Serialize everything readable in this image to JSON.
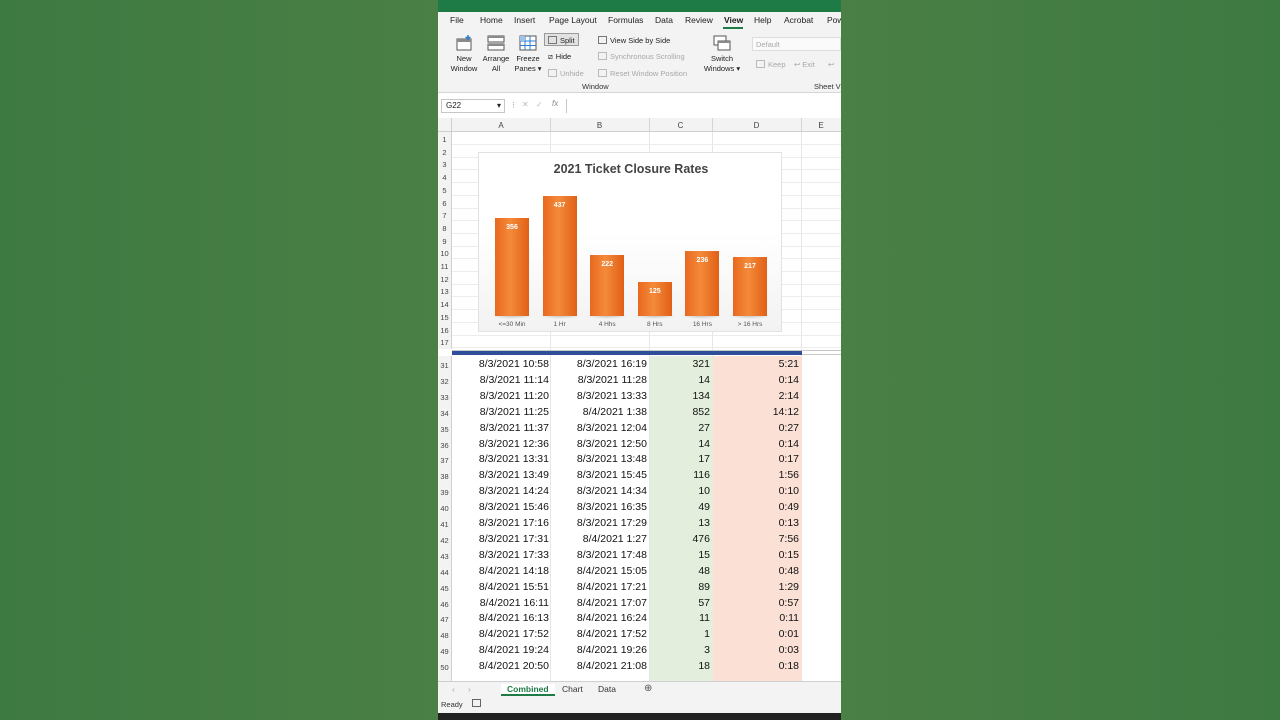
{
  "menu": {
    "items": [
      "File",
      "Home",
      "Insert",
      "Page Layout",
      "Formulas",
      "Data",
      "Review",
      "View",
      "Help",
      "Acrobat",
      "Pow"
    ],
    "active": "View"
  },
  "ribbon": {
    "new_window": "New\nWindow",
    "arrange_all": "Arrange\nAll",
    "freeze_panes": "Freeze\nPanes",
    "split": "Split",
    "hide": "Hide",
    "unhide": "Unhide",
    "view_side_by_side": "View Side by Side",
    "synchronous_scrolling": "Synchronous Scrolling",
    "reset_window_position": "Reset Window Position",
    "switch_windows": "Switch\nWindows",
    "default_sheet_view": "Default",
    "keep": "Keep",
    "exit": "Exit",
    "window_group": "Window",
    "sheet_view_group": "Sheet V"
  },
  "formula_bar": {
    "name_box": "G22",
    "fx": "fx",
    "content": ""
  },
  "columns": [
    "A",
    "B",
    "C",
    "D",
    "E"
  ],
  "top_rows": [
    "1",
    "2",
    "3",
    "4",
    "5",
    "6",
    "7",
    "8",
    "9",
    "10",
    "11",
    "12",
    "13",
    "14",
    "15",
    "16",
    "17"
  ],
  "chart_data": {
    "type": "bar",
    "title": "2021 Ticket Closure Rates",
    "categories": [
      "<=30 Min",
      "1 Hr",
      "4 Hhs",
      "8 Hrs",
      "16 Hrs",
      "> 16 Hrs"
    ],
    "values": [
      356,
      437,
      222,
      125,
      236,
      217
    ],
    "xlabel": "",
    "ylabel": "",
    "ylim": [
      0,
      500
    ],
    "grid": false,
    "legend": "none",
    "bar_color": "#ee7425"
  },
  "table_rows": [
    {
      "row": "31",
      "a": "8/3/2021 10:58",
      "b": "8/3/2021 16:19",
      "c": "321",
      "d": "5:21"
    },
    {
      "row": "32",
      "a": "8/3/2021 11:14",
      "b": "8/3/2021 11:28",
      "c": "14",
      "d": "0:14"
    },
    {
      "row": "33",
      "a": "8/3/2021 11:20",
      "b": "8/3/2021 13:33",
      "c": "134",
      "d": "2:14"
    },
    {
      "row": "34",
      "a": "8/3/2021 11:25",
      "b": "8/4/2021 1:38",
      "c": "852",
      "d": "14:12"
    },
    {
      "row": "35",
      "a": "8/3/2021 11:37",
      "b": "8/3/2021 12:04",
      "c": "27",
      "d": "0:27"
    },
    {
      "row": "36",
      "a": "8/3/2021 12:36",
      "b": "8/3/2021 12:50",
      "c": "14",
      "d": "0:14"
    },
    {
      "row": "37",
      "a": "8/3/2021 13:31",
      "b": "8/3/2021 13:48",
      "c": "17",
      "d": "0:17"
    },
    {
      "row": "38",
      "a": "8/3/2021 13:49",
      "b": "8/3/2021 15:45",
      "c": "116",
      "d": "1:56"
    },
    {
      "row": "39",
      "a": "8/3/2021 14:24",
      "b": "8/3/2021 14:34",
      "c": "10",
      "d": "0:10"
    },
    {
      "row": "40",
      "a": "8/3/2021 15:46",
      "b": "8/3/2021 16:35",
      "c": "49",
      "d": "0:49"
    },
    {
      "row": "41",
      "a": "8/3/2021 17:16",
      "b": "8/3/2021 17:29",
      "c": "13",
      "d": "0:13"
    },
    {
      "row": "42",
      "a": "8/3/2021 17:31",
      "b": "8/4/2021 1:27",
      "c": "476",
      "d": "7:56"
    },
    {
      "row": "43",
      "a": "8/3/2021 17:33",
      "b": "8/3/2021 17:48",
      "c": "15",
      "d": "0:15"
    },
    {
      "row": "44",
      "a": "8/4/2021 14:18",
      "b": "8/4/2021 15:05",
      "c": "48",
      "d": "0:48"
    },
    {
      "row": "45",
      "a": "8/4/2021 15:51",
      "b": "8/4/2021 17:21",
      "c": "89",
      "d": "1:29"
    },
    {
      "row": "46",
      "a": "8/4/2021 16:11",
      "b": "8/4/2021 17:07",
      "c": "57",
      "d": "0:57"
    },
    {
      "row": "47",
      "a": "8/4/2021 16:13",
      "b": "8/4/2021 16:24",
      "c": "11",
      "d": "0:11"
    },
    {
      "row": "48",
      "a": "8/4/2021 17:52",
      "b": "8/4/2021 17:52",
      "c": "1",
      "d": "0:01"
    },
    {
      "row": "49",
      "a": "8/4/2021 19:24",
      "b": "8/4/2021 19:26",
      "c": "3",
      "d": "0:03"
    },
    {
      "row": "50",
      "a": "8/4/2021 20:50",
      "b": "8/4/2021 21:08",
      "c": "18",
      "d": "0:18"
    }
  ],
  "sheet_tabs": [
    "Combined",
    "Chart",
    "Data"
  ],
  "active_tab": "Combined",
  "status": {
    "ready": "Ready"
  },
  "colors": {
    "excel_green": "#1e7b45",
    "col_c_fill": "#e3efdc",
    "col_d_fill": "#fbe0d6",
    "split_bar": "#2e4e9a"
  }
}
